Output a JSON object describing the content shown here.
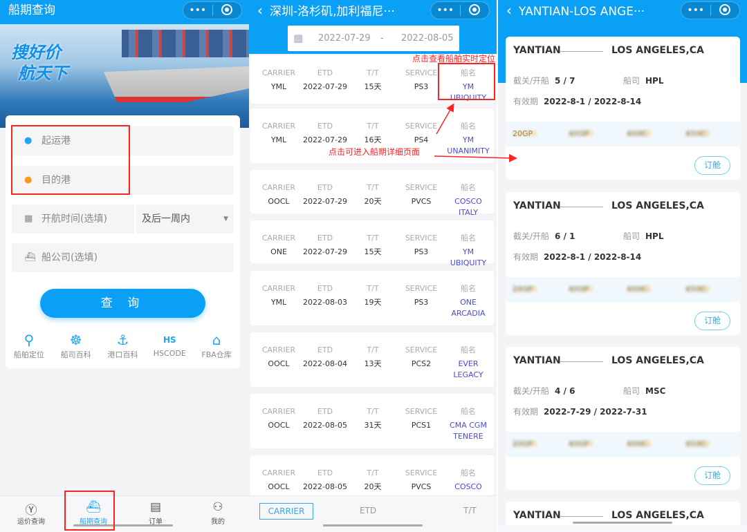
{
  "colors": {
    "primary": "#0aa0f5",
    "annotation": "#ff2222",
    "vessel_link": "#4a4ad8",
    "price": "#f5b43c"
  },
  "panel1": {
    "title": "船期查询",
    "banner_slogan": [
      "搜好价",
      "航天下"
    ],
    "fields": {
      "origin_placeholder": "起运港",
      "destination_placeholder": "目的港",
      "date_placeholder": "开航时间(选填)",
      "range_select": "及后一周内",
      "carrier_placeholder": "船公司(选填)"
    },
    "search_button": "查 询",
    "quick_links": [
      {
        "label": "船舶定位",
        "icon": "location-person-icon"
      },
      {
        "label": "船司百科",
        "icon": "ship-wheel-icon"
      },
      {
        "label": "港口百科",
        "icon": "anchor-icon"
      },
      {
        "label": "HSCODE",
        "icon": "hs-code-icon"
      },
      {
        "label": "FBA仓库",
        "icon": "warehouse-icon"
      }
    ],
    "tabbar": [
      {
        "label": "运价查询",
        "icon": "yen-icon"
      },
      {
        "label": "船期查询",
        "icon": "ship-icon",
        "active": true
      },
      {
        "label": "订单",
        "icon": "document-icon"
      },
      {
        "label": "我的",
        "icon": "user-icon"
      }
    ]
  },
  "panel2": {
    "title": "深圳-洛杉矶,加利福尼···",
    "date_from": "2022-07-29",
    "date_sep": "-",
    "date_to": "2022-08-05",
    "headers": [
      "CARRIER",
      "ETD",
      "T/T",
      "SERVICE",
      "船名"
    ],
    "rows": [
      [
        "YML",
        "2022-07-29",
        "15天",
        "PS3",
        "YM UBIQUITY"
      ],
      [
        "YML",
        "2022-07-29",
        "16天",
        "PS4",
        "YM UNANIMITY"
      ],
      [
        "OOCL",
        "2022-07-29",
        "20天",
        "PVCS",
        "COSCO ITALY"
      ],
      [
        "ONE",
        "2022-07-29",
        "15天",
        "PS3",
        "YM UBIQUITY"
      ],
      [
        "YML",
        "2022-08-03",
        "19天",
        "PS3",
        "ONE ARCADIA"
      ],
      [
        "OOCL",
        "2022-08-04",
        "13天",
        "PCS2",
        "EVER LEGACY"
      ],
      [
        "OOCL",
        "2022-08-05",
        "31天",
        "PCS1",
        "CMA CGM TENERE"
      ],
      [
        "OOCL",
        "2022-08-05",
        "20天",
        "PVCS",
        "COSCO"
      ]
    ],
    "sort_tabs": [
      "CARRIER",
      "ETD",
      "T/T"
    ],
    "annotations": {
      "vessel": "点击查看船舶实时定位",
      "detail": "点击可进入船期详细页面"
    }
  },
  "panel3": {
    "title": "YANTIAN-LOS ANGE···",
    "labels": {
      "cutoff": "截关/开船",
      "carrier": "船司",
      "validity": "有效期",
      "book": "订舱"
    },
    "cards": [
      {
        "from": "YANTIAN",
        "to": "LOS ANGELES,CA",
        "cutoff": "5 / 7",
        "carrier": "HPL",
        "validity": "2022-8-1 / 2022-8-14",
        "prices": [
          {
            "type": "20GP",
            "price": "$4000"
          },
          {
            "type": "40GP",
            "price": "$6000"
          },
          {
            "type": "40HC",
            "price": "$6000"
          },
          {
            "type": "45HC",
            "price": "$7000"
          }
        ]
      },
      {
        "from": "YANTIAN",
        "to": "LOS ANGELES,CA",
        "cutoff": "6 / 1",
        "carrier": "HPL",
        "validity": "2022-8-1 / 2022-8-14",
        "prices": [
          {
            "type": "20GP",
            "price": "$4000"
          },
          {
            "type": "40GP",
            "price": "$6000"
          },
          {
            "type": "40HC",
            "price": "$6000"
          },
          {
            "type": "45HC",
            "price": "$7000"
          }
        ]
      },
      {
        "from": "YANTIAN",
        "to": "LOS ANGELES,CA",
        "cutoff": "4 / 6",
        "carrier": "MSC",
        "validity": "2022-7-29 / 2022-7-31",
        "prices": [
          {
            "type": "20GP",
            "price": "$5100"
          },
          {
            "type": "40GP",
            "price": "$6550"
          },
          {
            "type": "40HC",
            "price": "$6600"
          },
          {
            "type": "45HC",
            "price": "$6300"
          }
        ]
      },
      {
        "from": "YANTIAN",
        "to": "LOS ANGELES,CA"
      }
    ]
  }
}
